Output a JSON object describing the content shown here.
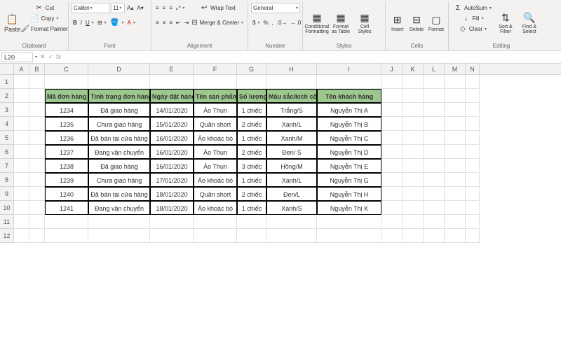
{
  "ribbon": {
    "clipboard": {
      "label": "Clipboard",
      "paste": "Paste",
      "cut": "Cut",
      "copy": "Copy",
      "painter": "Format Painter"
    },
    "font": {
      "label": "Font",
      "name": "Calibri",
      "size": "11"
    },
    "alignment": {
      "label": "Alignment",
      "wrap": "Wrap Text",
      "merge": "Merge & Center"
    },
    "number": {
      "label": "Number",
      "format": "General"
    },
    "styles": {
      "label": "Styles",
      "cond": "Conditional Formatting",
      "table": "Format as Table",
      "cell": "Cell Styles"
    },
    "cells": {
      "label": "Cells",
      "insert": "Insert",
      "delete": "Delete",
      "format": "Format"
    },
    "editing": {
      "label": "Editing",
      "autosum": "AutoSum",
      "fill": "Fill",
      "clear": "Clear",
      "sort": "Sort & Filter",
      "find": "Find & Select"
    }
  },
  "namebox": "L20",
  "columns": [
    "A",
    "B",
    "C",
    "D",
    "E",
    "F",
    "G",
    "H",
    "I",
    "J",
    "K",
    "L",
    "M",
    "N"
  ],
  "headers": [
    "Mã đơn hàng",
    "Tình trạng đơn hàng",
    "Ngày đặt hàng",
    "Tên sản phẩm",
    "Số lượng",
    "Màu sắc/kích cỡ",
    "Tên khách hàng"
  ],
  "rows": [
    [
      "1234",
      "Đã giao hàng",
      "14/01/2020",
      "Áo Thun",
      "1 chiếc",
      "Trắng/S",
      "Nguyễn Thị A"
    ],
    [
      "1235",
      "Chưa giao hàng",
      "15/01/2020",
      "Quần short",
      "2 chiếc",
      "Xanh/L",
      "Nguyễn Thị B"
    ],
    [
      "1236",
      "Đã bán tại cửa hàng",
      "16/01/2020",
      "Áo khoác bò",
      "1 chiếc",
      "Xanh/M",
      "Nguyễn Thị C"
    ],
    [
      "1237",
      "Đang vận chuyển",
      "16/01/2020",
      "Áo Thun",
      "2 chiếc",
      "Đen/ S",
      "Nguyễn Thị D"
    ],
    [
      "1238",
      "Đã giao hàng",
      "16/01/2020",
      "Áo Thun",
      "3 chiếc",
      "Hồng/M",
      "Nguyễn Thị E"
    ],
    [
      "1239",
      "Chưa giao hàng",
      "17/01/2020",
      "Áo khoác bò",
      "1 chiếc",
      "Xanh/L",
      "Nguyễn Thị G"
    ],
    [
      "1240",
      "Đã bán tại cửa hàng",
      "18/01/2020",
      "Quần short",
      "2 chiếc",
      "Đen/L",
      "Nguyễn Thị H"
    ],
    [
      "1241",
      "Đang vận chuyển",
      "18/01/2020",
      "Áo khoác bò",
      "1 chiếc",
      "Xanh/S",
      "Nguyễn Thị K"
    ]
  ]
}
